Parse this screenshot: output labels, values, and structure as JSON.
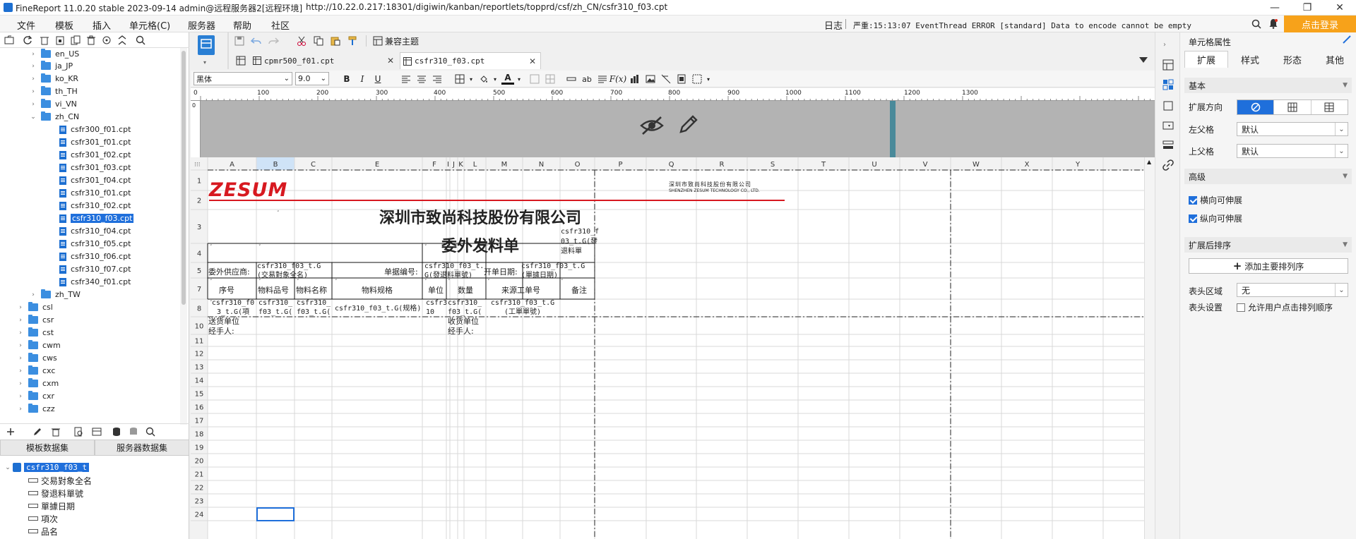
{
  "window": {
    "title": "FineReport 11.0.20 stable 2023-09-14 admin@远程服务器2[远程环境]",
    "url": "http://10.22.0.217:18301/digiwin/kanban/reportlets/topprd/csf/zh_CN/csfr310_f03.cpt",
    "minimize": "—",
    "restore": "❐",
    "close": "✕"
  },
  "menu": {
    "items": [
      "文件",
      "模板",
      "插入",
      "单元格(C)",
      "服务器",
      "帮助",
      "社区"
    ],
    "log_label": "日志",
    "log_message": "严重:15:13:07 EventThread ERROR [standard] Data to encode cannot be empty",
    "login_label": "点击登录"
  },
  "tree": {
    "folders_top": [
      "en_US",
      "ja_JP",
      "ko_KR",
      "th_TH",
      "vi_VN",
      "zh_CN"
    ],
    "files": [
      "csfr300_f01.cpt",
      "csfr301_f01.cpt",
      "csfr301_f02.cpt",
      "csfr301_f03.cpt",
      "csfr301_f04.cpt",
      "csfr310_f01.cpt",
      "csfr310_f02.cpt",
      "csfr310_f03.cpt",
      "csfr310_f04.cpt",
      "csfr310_f05.cpt",
      "csfr310_f06.cpt",
      "csfr310_f07.cpt",
      "csfr340_f01.cpt"
    ],
    "selected_file": "csfr310_f03.cpt",
    "folders_after": [
      "zh_TW"
    ],
    "folders_bottom": [
      "csl",
      "csr",
      "cst",
      "cwm",
      "cws",
      "cxc",
      "cxm",
      "cxr",
      "czz"
    ]
  },
  "datasets": {
    "tab_template": "模板数据集",
    "tab_server": "服务器数据集",
    "dataset_name": "csfr310_f03_t",
    "fields": [
      "交易對象全名",
      "發退料單號",
      "單據日期",
      "項次",
      "品名"
    ]
  },
  "editor": {
    "toolbar_theme_label": "兼容主题",
    "tabs": [
      {
        "label": "cpmr500_f01.cpt",
        "active": false
      },
      {
        "label": "csfr310_f03.cpt",
        "active": true
      }
    ],
    "font_name": "黑体",
    "font_size": "9.0",
    "ruler_ticks": [
      "0",
      "100",
      "200",
      "300",
      "400",
      "500",
      "600",
      "700",
      "800",
      "900",
      "1000",
      "1100",
      "1200",
      "1300"
    ]
  },
  "sheet": {
    "columns": [
      "A",
      "B",
      "C",
      "E",
      "F",
      "I",
      "J",
      "K",
      "L",
      "M",
      "N",
      "O",
      "P",
      "Q",
      "R",
      "S",
      "T",
      "U",
      "V",
      "W",
      "X",
      "Y"
    ],
    "rows": [
      "1",
      "2",
      "3",
      "4",
      "5",
      "7",
      "8",
      "10",
      "11",
      "12",
      "13",
      "14",
      "15",
      "16",
      "17",
      "18",
      "19",
      "20",
      "21",
      "22",
      "23",
      "24"
    ],
    "logo": "ZESUM",
    "company_cn_small": "深圳市致尚科技股份有限公司",
    "company_en_small": "SHENZHEN ZESUM TECHNOLOGY CO., LTD.",
    "company_title": "深圳市致尚科技股份有限公司",
    "doc_title": "委外发料单",
    "cell_n3": "csfr310_f03_t.G(發退料單",
    "label_supplier": "委外供应商:",
    "cell_supplier": "csfr310_f03_t.G(交易對象全名)",
    "label_docno": "单据编号:",
    "cell_docno": "csfr310_f03_t.G(發退料單號)",
    "label_date": "开单日期:",
    "cell_date": "csfr310_f03_t.G(單據日期)",
    "headers": [
      "序号",
      "物料品号",
      "物料名称",
      "物料规格",
      "单位",
      "数量",
      "来源工单号",
      "备注"
    ],
    "data_row": [
      "csfr310_f03_t.G(項",
      "csfr310_f03_t.G(",
      "csfr310_f03_t.G(",
      "csfr310_f03_t.G(规格)",
      "csfr310",
      "csfr310_f03_t.G(",
      "csfr310_f03_t.G(工單單號)",
      ""
    ],
    "footer_left": "送货单位\n经手人:",
    "footer_right": "收货单位\n经手人:"
  },
  "props": {
    "panel_title": "单元格属性",
    "tabs": [
      "扩展",
      "样式",
      "形态",
      "其他"
    ],
    "section_basic": "基本",
    "expand_dir_label": "扩展方向",
    "left_parent_label": "左父格",
    "left_parent_value": "默认",
    "top_parent_label": "上父格",
    "top_parent_value": "默认",
    "section_advanced": "高级",
    "h_expand": "横向可伸展",
    "v_expand": "纵向可伸展",
    "section_sort": "扩展后排序",
    "add_sort_label": "添加主要排列序",
    "header_area_label": "表头区域",
    "header_area_value": "无",
    "header_setting_label": "表头设置",
    "header_setting_option": "允许用户点击排列顺序"
  },
  "colors": {
    "accent": "#1f6fdb",
    "login": "#f7a21a",
    "logo": "#d71920",
    "preview": "#bdbdbd",
    "ruler_mark": "#4a8a9a"
  }
}
